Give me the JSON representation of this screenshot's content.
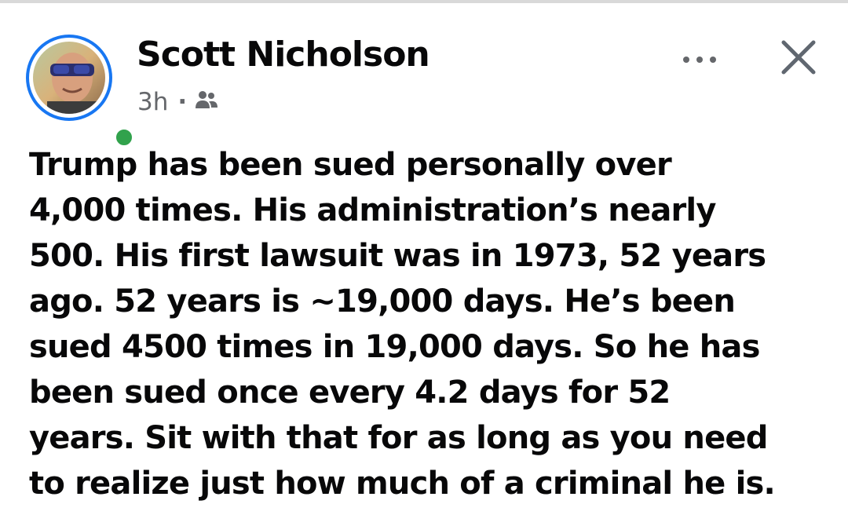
{
  "post": {
    "author": "Scott Nicholson",
    "timestamp": "3h",
    "separator": "·",
    "audience_icon": "friends-icon",
    "more_icon": "more-options-icon",
    "close_icon": "close-icon",
    "online_status_color": "#31a24c",
    "avatar_ring_color": "#1877f2",
    "text_lines": [
      "Trump has been sued personally over",
      "4,000 times. His administration’s nearly",
      "500. His first lawsuit was in 1973, 52 years",
      "ago. 52 years is ~19,000 days. He’s been",
      "sued 4500 times in 19,000 days. So he has",
      "been sued once every 4.2 days for 52",
      "years. Sit with that for as long as you need",
      "to realize just how much of a criminal he is."
    ]
  }
}
